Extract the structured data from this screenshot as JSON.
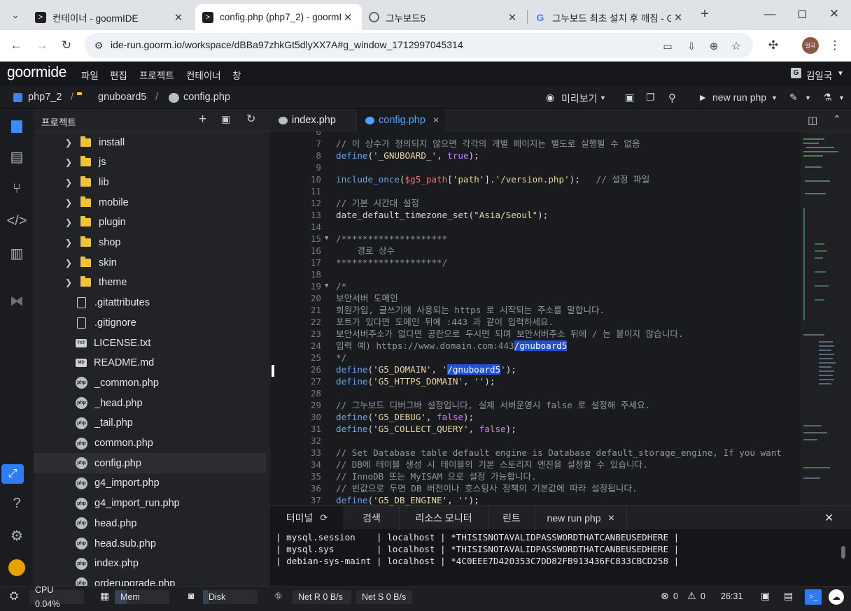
{
  "browser": {
    "tabs": [
      {
        "title": "컨테이너 - goormIDE",
        "active": false
      },
      {
        "title": "config.php (php7_2) - goormIDE",
        "active": true
      },
      {
        "title": "그누보드5",
        "active": false
      },
      {
        "title": "그누보드 최초 설치 후 깨짐 - G",
        "active": false
      }
    ],
    "url": "ide-run.goorm.io/workspace/dBBa97zhkGt5dlyXX7A#g_window_1712997045314",
    "profile": "일국"
  },
  "ide": {
    "logo": "goormide",
    "menu": [
      "파일",
      "편집",
      "프로젝트",
      "컨테이너",
      "창"
    ],
    "user": "김일국",
    "breadcrumb": [
      "php7_2",
      "gnuboard5",
      "config.php"
    ],
    "preview_label": "미리보기",
    "run_label": "new run php"
  },
  "project": {
    "title": "프로젝트",
    "items": [
      {
        "name": "install",
        "type": "folder"
      },
      {
        "name": "js",
        "type": "folder"
      },
      {
        "name": "lib",
        "type": "folder"
      },
      {
        "name": "mobile",
        "type": "folder"
      },
      {
        "name": "plugin",
        "type": "folder"
      },
      {
        "name": "shop",
        "type": "folder"
      },
      {
        "name": "skin",
        "type": "folder"
      },
      {
        "name": "theme",
        "type": "folder"
      },
      {
        "name": ".gitattributes",
        "type": "doc"
      },
      {
        "name": ".gitignore",
        "type": "doc"
      },
      {
        "name": "LICENSE.txt",
        "type": "txt"
      },
      {
        "name": "README.md",
        "type": "md"
      },
      {
        "name": "_common.php",
        "type": "php"
      },
      {
        "name": "_head.php",
        "type": "php"
      },
      {
        "name": "_tail.php",
        "type": "php"
      },
      {
        "name": "common.php",
        "type": "php"
      },
      {
        "name": "config.php",
        "type": "php",
        "selected": true
      },
      {
        "name": "g4_import.php",
        "type": "php"
      },
      {
        "name": "g4_import_run.php",
        "type": "php"
      },
      {
        "name": "head.php",
        "type": "php"
      },
      {
        "name": "head.sub.php",
        "type": "php"
      },
      {
        "name": "index.php",
        "type": "php"
      },
      {
        "name": "orderupgrade.php",
        "type": "php"
      }
    ]
  },
  "editor": {
    "tabs": [
      "index.php",
      "config.php"
    ],
    "active_tab": "config.php",
    "lines": [
      {
        "n": "6",
        "t": []
      },
      {
        "n": "7",
        "t": [
          [
            "c-com",
            "// 이 상수가 정의되지 않으면 각각의 개별 페이지는 별도로 실행될 수 없음"
          ]
        ]
      },
      {
        "n": "8",
        "t": [
          [
            "c-kw",
            "define"
          ],
          [
            "c-pl",
            "("
          ],
          [
            "c-str",
            "'_GNUBOARD_'"
          ],
          [
            "c-pl",
            ", "
          ],
          [
            "c-bool",
            "true"
          ],
          [
            "c-pl",
            ");"
          ]
        ]
      },
      {
        "n": "9",
        "t": []
      },
      {
        "n": "10",
        "t": [
          [
            "c-kw",
            "include_once"
          ],
          [
            "c-pl",
            "("
          ],
          [
            "c-var",
            "$g5_path"
          ],
          [
            "c-pl",
            "["
          ],
          [
            "c-str",
            "'path'"
          ],
          [
            "c-pl",
            "]."
          ],
          [
            "c-str",
            "'/version.php'"
          ],
          [
            "c-pl",
            ");   "
          ],
          [
            "c-com",
            "// 설정 파일"
          ]
        ]
      },
      {
        "n": "11",
        "t": []
      },
      {
        "n": "12",
        "t": [
          [
            "c-com",
            "// 기본 시간대 설정"
          ]
        ]
      },
      {
        "n": "13",
        "t": [
          [
            "c-pl",
            "date_default_timezone_set("
          ],
          [
            "c-str",
            "\"Asia/Seoul\""
          ],
          [
            "c-pl",
            ");"
          ]
        ]
      },
      {
        "n": "14",
        "t": []
      },
      {
        "n": "15",
        "fold": true,
        "t": [
          [
            "c-com",
            "/********************"
          ]
        ]
      },
      {
        "n": "16",
        "t": [
          [
            "c-com",
            "    경로 상수"
          ]
        ]
      },
      {
        "n": "17",
        "t": [
          [
            "c-com",
            "********************/"
          ]
        ]
      },
      {
        "n": "18",
        "t": []
      },
      {
        "n": "19",
        "fold": true,
        "t": [
          [
            "c-com",
            "/*"
          ]
        ]
      },
      {
        "n": "20",
        "t": [
          [
            "c-com",
            "보안서버 도메인"
          ]
        ]
      },
      {
        "n": "21",
        "t": [
          [
            "c-com",
            "회원가입, 글쓰기에 사용되는 https 로 시작되는 주소를 말합니다."
          ]
        ]
      },
      {
        "n": "22",
        "t": [
          [
            "c-com",
            "포트가 있다면 도메인 뒤에 :443 과 같이 입력하세요."
          ]
        ]
      },
      {
        "n": "23",
        "t": [
          [
            "c-com",
            "보안서버주소가 없다면 공란으로 두시면 되며 보안서버주소 뒤에 / 는 붙이지 않습니다."
          ]
        ]
      },
      {
        "n": "24",
        "t": [
          [
            "c-com",
            "입력 예) https://www.domain.com:443"
          ],
          [
            "c-sel",
            "/gnuboard5"
          ]
        ]
      },
      {
        "n": "25",
        "t": [
          [
            "c-com",
            "*/"
          ]
        ]
      },
      {
        "n": "26",
        "t": [
          [
            "c-kw",
            "define"
          ],
          [
            "c-pl",
            "("
          ],
          [
            "c-str",
            "'G5_DOMAIN'"
          ],
          [
            "c-pl",
            ", "
          ],
          [
            "c-str",
            "'"
          ],
          [
            "c-sel",
            "/gnuboard5"
          ],
          [
            "c-str",
            "'"
          ],
          [
            "c-pl",
            ");"
          ]
        ]
      },
      {
        "n": "27",
        "t": [
          [
            "c-kw",
            "define"
          ],
          [
            "c-pl",
            "("
          ],
          [
            "c-str",
            "'G5_HTTPS_DOMAIN'"
          ],
          [
            "c-pl",
            ", "
          ],
          [
            "c-str",
            "''"
          ],
          [
            "c-pl",
            ");"
          ]
        ]
      },
      {
        "n": "28",
        "t": []
      },
      {
        "n": "29",
        "t": [
          [
            "c-com",
            "// 그누보드 디버그바 설정입니다, 실제 서버운영시 false 로 설정해 주세요."
          ]
        ]
      },
      {
        "n": "30",
        "t": [
          [
            "c-kw",
            "define"
          ],
          [
            "c-pl",
            "("
          ],
          [
            "c-str",
            "'G5_DEBUG'"
          ],
          [
            "c-pl",
            ", "
          ],
          [
            "c-bool",
            "false"
          ],
          [
            "c-pl",
            ");"
          ]
        ]
      },
      {
        "n": "31",
        "t": [
          [
            "c-kw",
            "define"
          ],
          [
            "c-pl",
            "("
          ],
          [
            "c-str",
            "'G5_COLLECT_QUERY'"
          ],
          [
            "c-pl",
            ", "
          ],
          [
            "c-bool",
            "false"
          ],
          [
            "c-pl",
            ");"
          ]
        ]
      },
      {
        "n": "32",
        "t": []
      },
      {
        "n": "33",
        "t": [
          [
            "c-com",
            "// Set Database table default engine is Database default_storage_engine, If you want"
          ]
        ]
      },
      {
        "n": "34",
        "t": [
          [
            "c-com",
            "// DB에 테이블 생성 시 테이블의 기본 스토리지 엔진을 설정할 수 있습니다."
          ]
        ]
      },
      {
        "n": "35",
        "t": [
          [
            "c-com",
            "// InnoDB 또는 MyISAM 으로 설정 가능합니다."
          ]
        ]
      },
      {
        "n": "36",
        "t": [
          [
            "c-com",
            "// 빈값으로 두면 DB 버전이나 호스팅사 정책의 기본값에 따라 설정됩니다."
          ]
        ]
      },
      {
        "n": "37",
        "t": [
          [
            "c-kw",
            "define"
          ],
          [
            "c-pl",
            "("
          ],
          [
            "c-str",
            "'G5_DB_ENGINE'"
          ],
          [
            "c-pl",
            ", "
          ],
          [
            "c-str",
            "''"
          ],
          [
            "c-pl",
            ");"
          ]
        ]
      }
    ]
  },
  "terminal": {
    "tabs": [
      "터미널",
      "검색",
      "리소스 모니터",
      "린트",
      "new run php"
    ],
    "lines": [
      "| mysql.session    | localhost | *THISISNOTAVALIDPASSWORDTHATCANBEUSEDHERE |",
      "| mysql.sys        | localhost | *THISISNOTAVALIDPASSWORDTHATCANBEUSEDHERE |",
      "| debian-sys-maint | localhost | *4C0EEE7D420353C7DD82FB913436FC833CBCD258 |"
    ]
  },
  "status": {
    "cpu": "CPU 0.04%",
    "mem": "Mem 21.44%",
    "disk": "Disk 10.64%",
    "net_r": "Net R 0 B/s",
    "net_s": "Net S 0 B/s",
    "errors": "0",
    "warnings": "0",
    "cursor": "26:31",
    "mem_fraction": 0.2144,
    "disk_fraction": 0.1064
  }
}
